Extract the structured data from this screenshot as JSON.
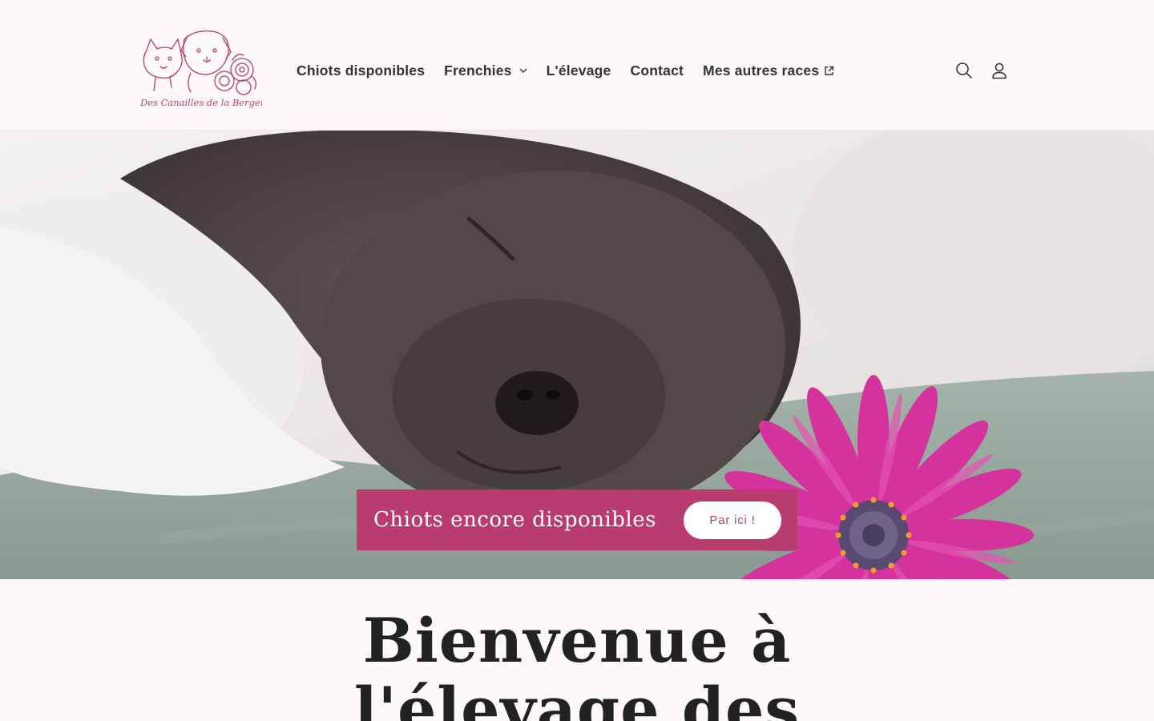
{
  "brand": {
    "logo_name": "Des Canailles de la Bergerie",
    "accent_color": "#b83c6e"
  },
  "nav": {
    "items": [
      {
        "label": "Chiots disponibles"
      },
      {
        "label": "Frenchies"
      },
      {
        "label": "L'élevage"
      },
      {
        "label": "Contact"
      },
      {
        "label": "Mes autres races"
      }
    ]
  },
  "header_icons": [
    "search-icon",
    "account-icon"
  ],
  "hero": {
    "banner_title": "Chiots encore disponibles",
    "banner_button": "Par ici !"
  },
  "welcome": {
    "line1": "Bienvenue à",
    "line2": "l'élevage des"
  }
}
